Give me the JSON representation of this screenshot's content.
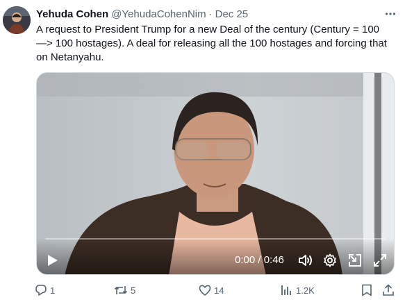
{
  "tweet": {
    "author_name": "Yehuda Cohen",
    "author_handle": "@YehudaCohenNim",
    "separator": "·",
    "date": "Dec 25",
    "more_label": "···",
    "text": "A request to President Trump for a new Deal of the century (Century = 100\n—> 100 hostages). A deal for releasing all the 100 hostages and forcing that\non Netanyahu."
  },
  "video": {
    "time_display": "0:00 / 0:46",
    "progress_fraction": 0.0,
    "icons": [
      "play-icon",
      "volume-icon",
      "settings-gear-icon",
      "picture-in-picture-icon",
      "fullscreen-icon"
    ]
  },
  "actions": {
    "replies": "1",
    "reposts": "5",
    "likes": "14",
    "views": "1.2K"
  },
  "colors": {
    "text": "#0f1419",
    "secondary": "#536471",
    "border": "#cfd9de"
  }
}
